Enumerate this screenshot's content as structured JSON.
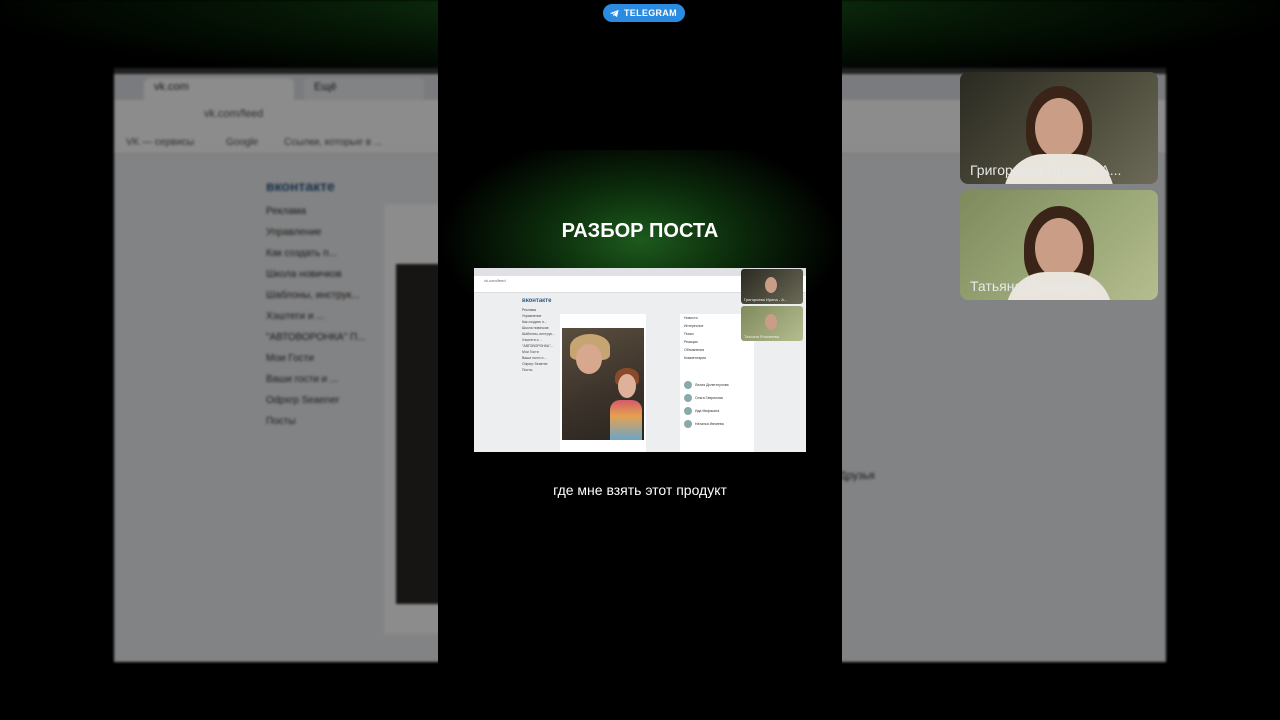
{
  "background": {
    "tabs": [
      "vk.com",
      "Ещё"
    ],
    "url": "vk.com/feed",
    "bookmarks": [
      "VK — сервисы",
      "Google",
      "Ссылки, которые в ..."
    ],
    "logo": "вконтакте",
    "menu": [
      "Реклама",
      "Управление",
      "Как создать п...",
      "Школа новичков",
      "Шаблоны, инструк...",
      "Хэштеги и ...",
      "\"АВТОВОРОНКА\" П...",
      "Мои Гости",
      "Ваши гости и ...",
      "Odpxrp Seaener",
      "Посты"
    ],
    "friends_title": "Друзья"
  },
  "participants": [
    {
      "name": "Григорьева Ирина - А...",
      "bg": "#4a4838"
    },
    {
      "name": "Татьяна Рогознева",
      "bg": "#9aa776"
    }
  ],
  "center": {
    "badge": "TELEGRAM",
    "badge_color": "#2a8be0",
    "headline": "РАЗБОР ПОСТА",
    "subtitle": "где мне взять этот продукт"
  },
  "mini": {
    "url": "vk.com/feed",
    "logo": "вконтакте",
    "menu": [
      "Реклама",
      "Управление",
      "Как создать п...",
      "Школа новичков",
      "Шаблоны, инструк...",
      "Хэштеги и ...",
      "\"АВТОВОРОНКА\"...",
      "Мои Гости",
      "Ваши гости и ...",
      "Odpxrp Seaener",
      "Посты"
    ],
    "right": [
      "Новости",
      "Интересное",
      "Поиск",
      "Реакции",
      "Обновления",
      "Комментарии"
    ],
    "friends": [
      "Лилия Дилегатулова",
      "Ольга Гаврилова",
      "Ида Мифаката",
      "Наталья Ивлиева"
    ],
    "tiles": [
      "Григорьева Ирина - А...",
      "Татьяна Рогознева"
    ]
  }
}
